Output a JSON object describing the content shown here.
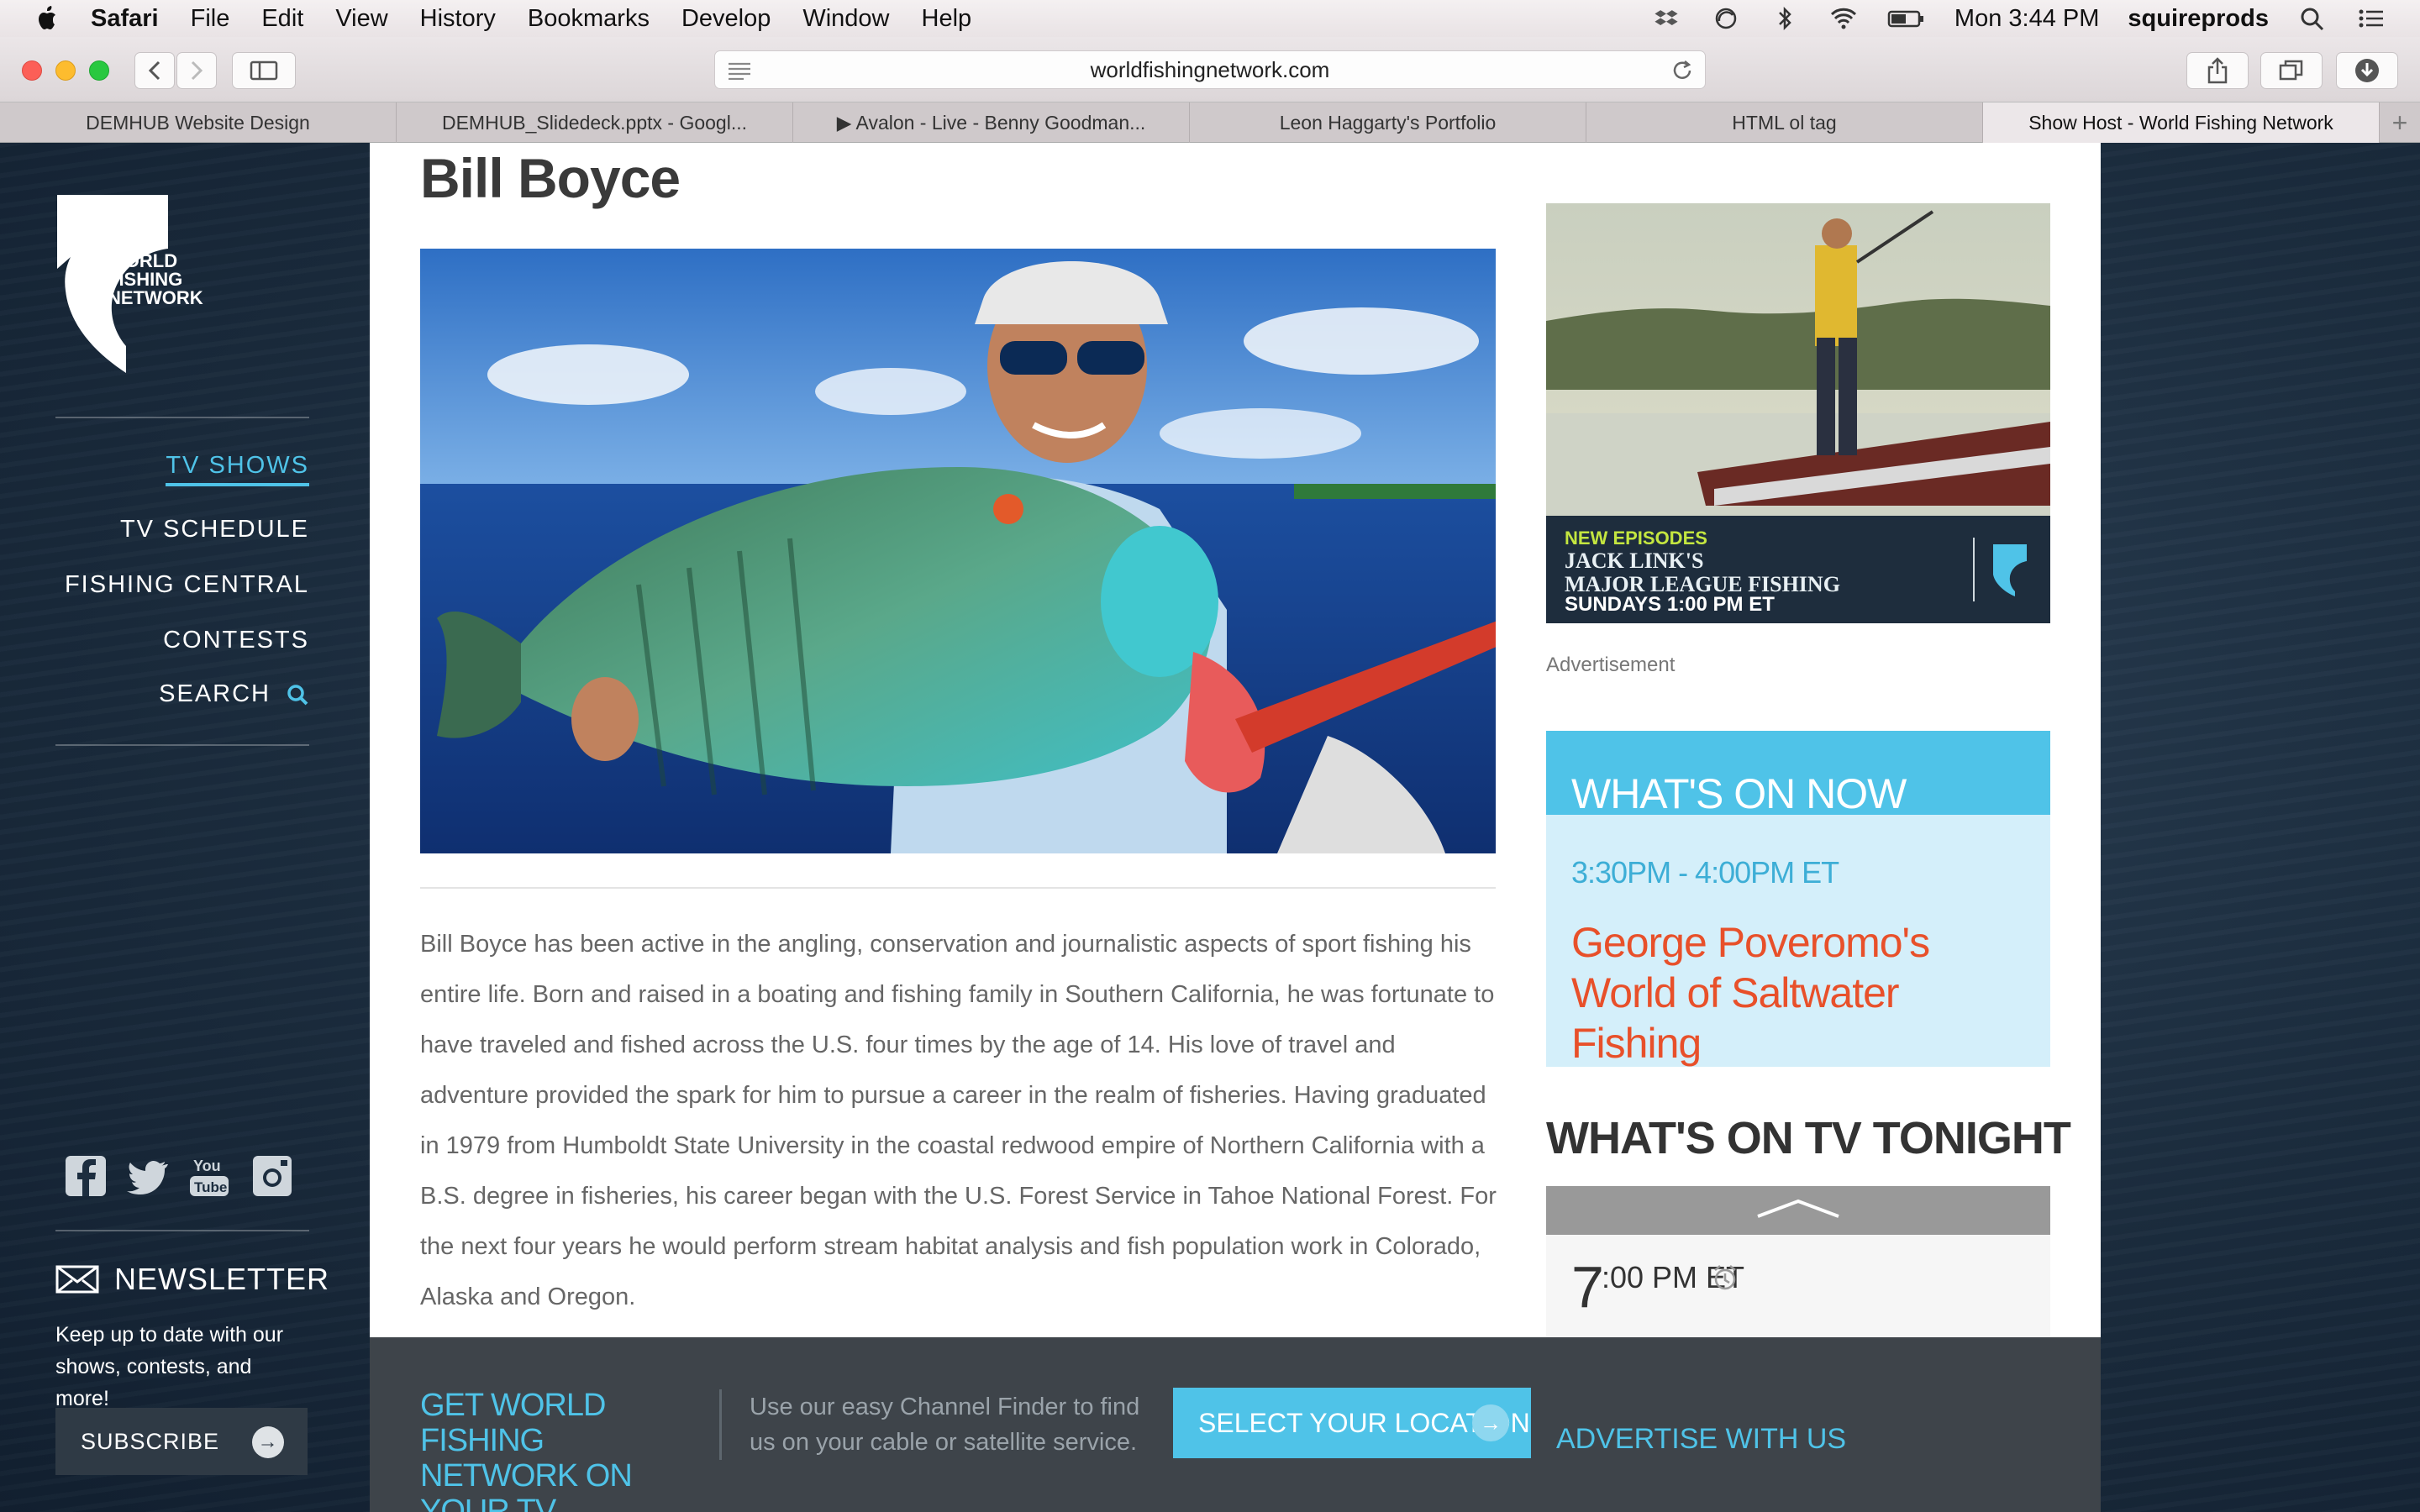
{
  "menubar": {
    "app": "Safari",
    "items": [
      "File",
      "Edit",
      "View",
      "History",
      "Bookmarks",
      "Develop",
      "Window",
      "Help"
    ],
    "clock": "Mon 3:44 PM",
    "user": "squireprods"
  },
  "browser": {
    "url": "worldfishingnetwork.com",
    "tabs": [
      {
        "title": "DEMHUB Website Design",
        "active": false
      },
      {
        "title": "DEMHUB_Slidedeck.pptx - Googl...",
        "active": false
      },
      {
        "title": "▶ Avalon - Live - Benny Goodman...",
        "active": false
      },
      {
        "title": "Leon Haggarty's Portfolio",
        "active": false
      },
      {
        "title": "HTML ol tag",
        "active": false
      },
      {
        "title": "Show Host - World Fishing Network",
        "active": true
      }
    ],
    "new_tab": "+"
  },
  "sidebar": {
    "logo_text": [
      "WORLD",
      "FISHING",
      "NETWORK"
    ],
    "nav": [
      {
        "label": "TV SHOWS",
        "active": true
      },
      {
        "label": "TV SCHEDULE",
        "active": false
      },
      {
        "label": "FISHING CENTRAL",
        "active": false
      },
      {
        "label": "CONTESTS",
        "active": false
      },
      {
        "label": "SEARCH",
        "active": false
      }
    ],
    "social_icons": [
      "facebook-icon",
      "twitter-icon",
      "youtube-icon",
      "instagram-icon"
    ],
    "newsletter": {
      "title": "NEWSLETTER",
      "description": "Keep up to date with our shows, contests, and more!",
      "button": "SUBSCRIBE"
    }
  },
  "main": {
    "title": "Bill Boyce",
    "bio": "Bill Boyce has been active in the angling, conservation and journalistic aspects of sport fishing his entire life. Born and raised in a boating and fishing family in Southern California, he was fortunate to have traveled and fished across the U.S. four times by the age of 14. His love of travel and adventure provided the spark for him to pursue a career in the realm of fisheries. Having graduated in 1979 from Humboldt State University in the coastal redwood empire of Northern California with a B.S. degree in fisheries, his career began with the U.S. Forest Service in Tahoe National Forest. For the next four years he would perform stream habitat analysis and fish population work in Colorado, Alaska and Oregon."
  },
  "ad": {
    "line1": "NEW EPISODES",
    "line2": "JACK LINK'S",
    "line3": "MAJOR LEAGUE FISHING",
    "line4": "SUNDAYS 1:00 PM ET",
    "label": "Advertisement"
  },
  "whats_on_now": {
    "title": "WHAT'S ON NOW",
    "time": "3:30PM - 4:00PM ET",
    "show": "George Poveromo's World of Saltwater Fishing"
  },
  "tonight": {
    "title": "WHAT'S ON TV TONIGHT",
    "slot_hour": "7",
    "slot_rest": ":00 PM ET"
  },
  "sticky": {
    "get_tv": "GET WORLD FISHING NETWORK ON YOUR TV",
    "finder": "Use our easy Channel Finder to find us on your cable or satellite service.",
    "select_location": "SELECT YOUR LOCATION",
    "advertise": "ADVERTISE WITH US"
  },
  "colors": {
    "accent": "#4fc3e8",
    "show_title": "#e8502a",
    "sidebar_bg": "#1c2d3f"
  }
}
